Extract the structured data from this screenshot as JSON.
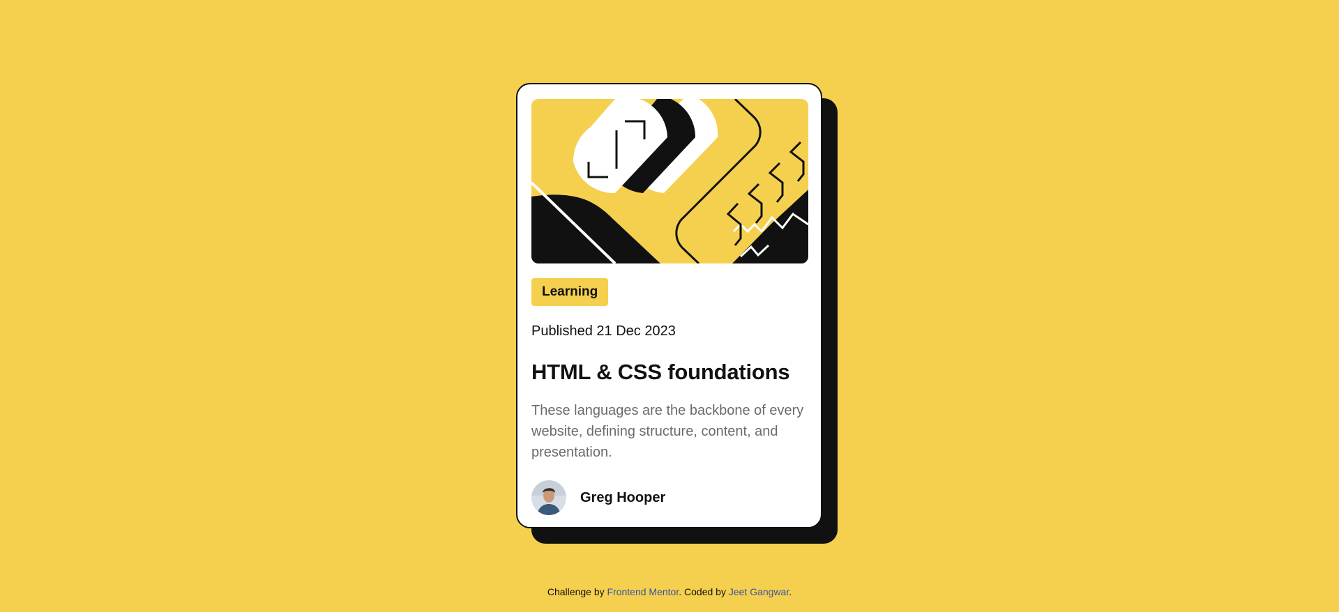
{
  "card": {
    "tag": "Learning",
    "published": "Published 21 Dec 2023",
    "title": "HTML & CSS foundations",
    "description": "These languages are the backbone of every website, defining structure, content, and presentation.",
    "author_name": "Greg Hooper",
    "hero_image": "html-css-illustration",
    "avatar_image": "author-avatar"
  },
  "attribution": {
    "prefix": "Challenge by ",
    "link1": "Frontend Mentor",
    "middle": ". Coded by ",
    "link2": "Jeet Gangwar",
    "suffix": "."
  },
  "colors": {
    "background": "#f4d04e",
    "card": "#ffffff",
    "ink": "#111111",
    "muted": "#6b6b6b",
    "link": "#3e52a3"
  }
}
